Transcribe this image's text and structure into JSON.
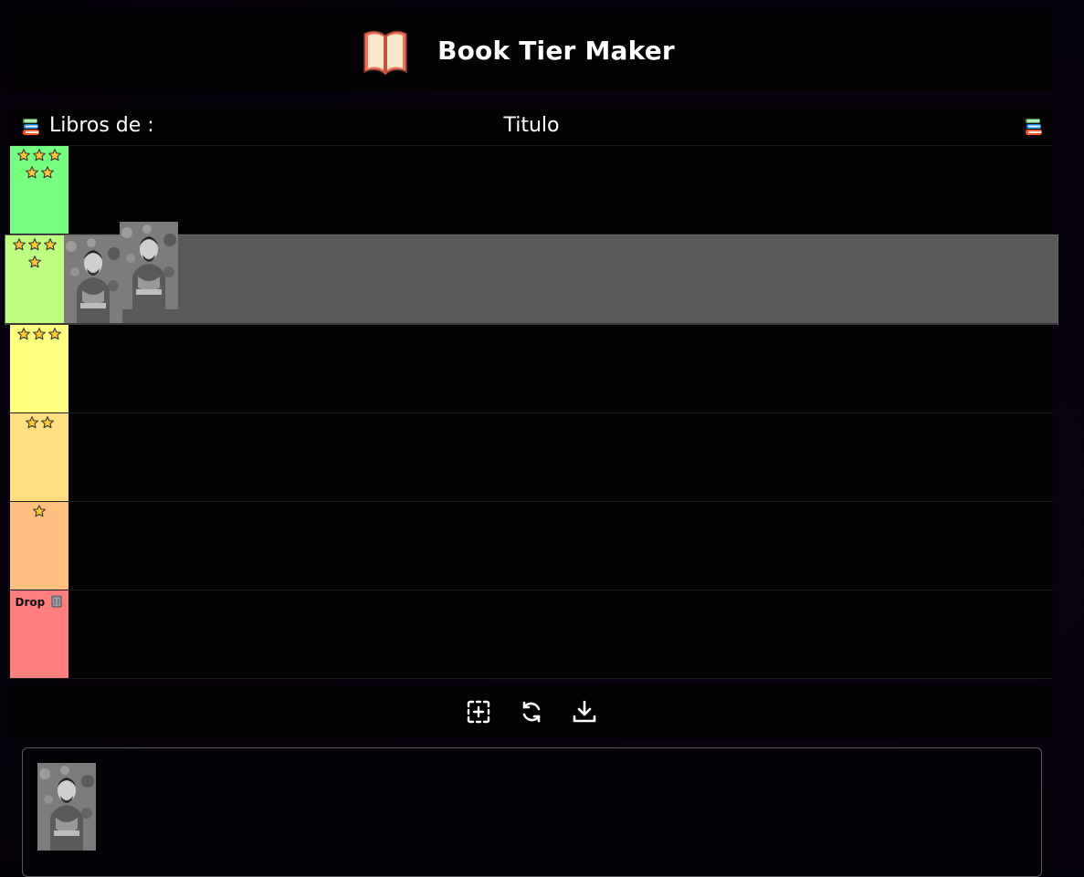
{
  "app": {
    "title": "Book Tier Maker",
    "logo_icon": "open-book-icon"
  },
  "board": {
    "owner_label": "Libros de :",
    "title_placeholder": "Titulo",
    "books_icon": "books-stack-icon"
  },
  "tiers": [
    {
      "id": "tier-5",
      "stars": 5,
      "color": "#77ff7f",
      "label": ""
    },
    {
      "id": "tier-4",
      "stars": 4,
      "color": "#bfff7f",
      "label": ""
    },
    {
      "id": "tier-3",
      "stars": 3,
      "color": "#ffff7f",
      "label": ""
    },
    {
      "id": "tier-2",
      "stars": 2,
      "color": "#ffdf80",
      "label": ""
    },
    {
      "id": "tier-1",
      "stars": 1,
      "color": "#ffbf7f",
      "label": ""
    },
    {
      "id": "tier-drop",
      "stars": 0,
      "color": "#ff7f7f",
      "label": "Drop",
      "icon": "trash-icon"
    }
  ],
  "toolbar": {
    "buttons": [
      {
        "name": "add-image-button",
        "icon": "add-square-icon"
      },
      {
        "name": "reset-button",
        "icon": "refresh-icon"
      },
      {
        "name": "download-button",
        "icon": "download-icon"
      }
    ]
  },
  "colors": {
    "dragover_row": "#5a5a5a",
    "background": "#07020c"
  }
}
